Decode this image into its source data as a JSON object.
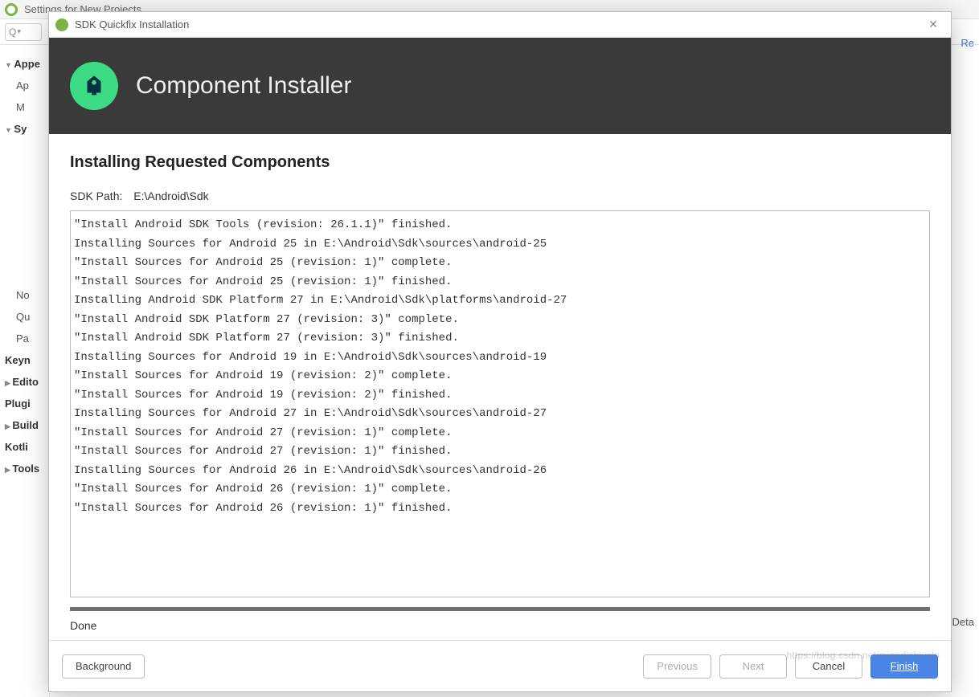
{
  "parent": {
    "title": "Settings for New Projects",
    "search_placeholder": "Q",
    "right_link": "Re",
    "bottom_right": "Deta",
    "bottom_right2": "elp",
    "sidebar": {
      "items": [
        {
          "label": "Appe",
          "bold": true
        },
        {
          "label": "Ap",
          "indent": true
        },
        {
          "label": "M",
          "indent": true
        },
        {
          "label": "Sy",
          "bold": true
        },
        {
          "label": "No",
          "indent": true
        },
        {
          "label": "Qu",
          "indent": true
        },
        {
          "label": "Pa",
          "indent": true
        },
        {
          "label": "Keyn",
          "bold": true
        },
        {
          "label": "Edito",
          "bold": true
        },
        {
          "label": "Plugi",
          "bold": true
        },
        {
          "label": "Build",
          "bold": true
        },
        {
          "label": "Kotli",
          "bold": true
        },
        {
          "label": "Tools",
          "bold": true
        }
      ]
    }
  },
  "dialog": {
    "window_title": "SDK Quickfix Installation",
    "banner_title": "Component Installer",
    "section_title": "Installing Requested Components",
    "sdk_path_label": "SDK Path:",
    "sdk_path_value": "E:\\Android\\Sdk",
    "log_lines": [
      "\"Install Android SDK Tools (revision: 26.1.1)\" finished.",
      "Installing Sources for Android 25 in E:\\Android\\Sdk\\sources\\android-25",
      "\"Install Sources for Android 25 (revision: 1)\" complete.",
      "\"Install Sources for Android 25 (revision: 1)\" finished.",
      "Installing Android SDK Platform 27 in E:\\Android\\Sdk\\platforms\\android-27",
      "\"Install Android SDK Platform 27 (revision: 3)\" complete.",
      "\"Install Android SDK Platform 27 (revision: 3)\" finished.",
      "Installing Sources for Android 19 in E:\\Android\\Sdk\\sources\\android-19",
      "\"Install Sources for Android 19 (revision: 2)\" complete.",
      "\"Install Sources for Android 19 (revision: 2)\" finished.",
      "Installing Sources for Android 27 in E:\\Android\\Sdk\\sources\\android-27",
      "\"Install Sources for Android 27 (revision: 1)\" complete.",
      "\"Install Sources for Android 27 (revision: 1)\" finished.",
      "Installing Sources for Android 26 in E:\\Android\\Sdk\\sources\\android-26",
      "\"Install Sources for Android 26 (revision: 1)\" complete.",
      "\"Install Sources for Android 26 (revision: 1)\" finished."
    ],
    "status": "Done",
    "buttons": {
      "background": "Background",
      "previous": "Previous",
      "next": "Next",
      "cancel": "Cancel",
      "finish": "Finish"
    }
  },
  "watermark": "https://blog.csdn.net/miaodichiyelp",
  "colors": {
    "accent_green": "#3ddc84",
    "banner_bg": "#3a3a3a",
    "primary_btn": "#4a86e8"
  }
}
